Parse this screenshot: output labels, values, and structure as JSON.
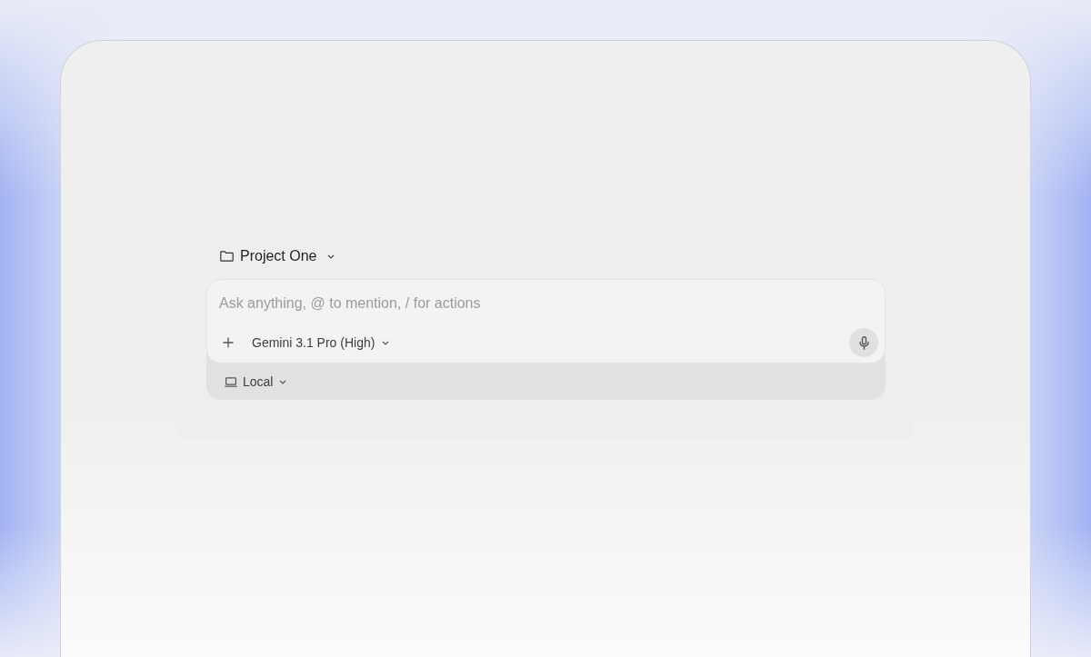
{
  "project": {
    "name": "Project One"
  },
  "composer": {
    "input": {
      "placeholder": "Ask anything, @ to mention, / for actions"
    },
    "model": "Gemini 3.1 Pro (High)",
    "environment": "Local"
  }
}
